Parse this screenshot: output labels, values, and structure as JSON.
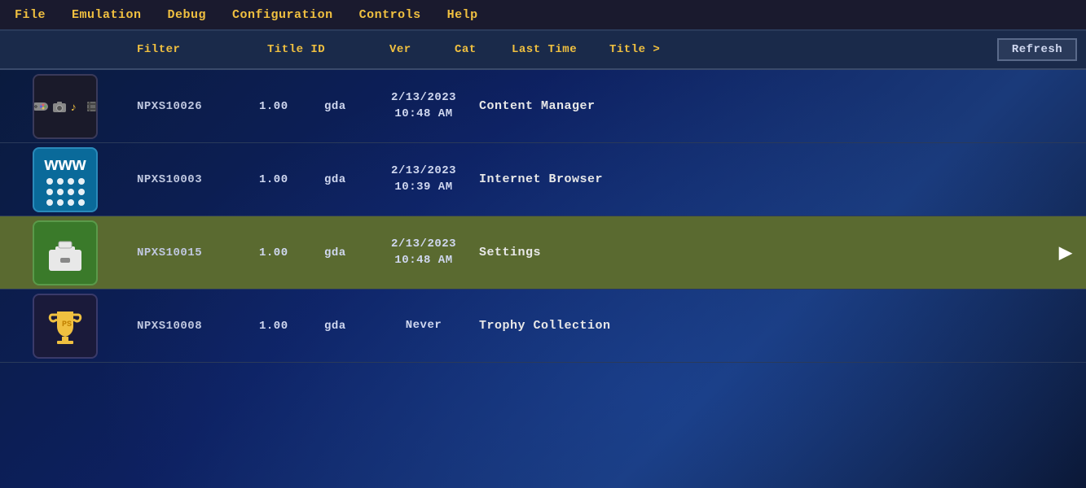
{
  "menubar": {
    "items": [
      {
        "id": "file",
        "label": "File"
      },
      {
        "id": "emulation",
        "label": "Emulation"
      },
      {
        "id": "debug",
        "label": "Debug"
      },
      {
        "id": "configuration",
        "label": "Configuration"
      },
      {
        "id": "controls",
        "label": "Controls"
      },
      {
        "id": "help",
        "label": "Help"
      }
    ]
  },
  "table": {
    "headers": {
      "filter": "Filter",
      "titleid": "Title ID",
      "ver": "Ver",
      "cat": "Cat",
      "lasttime": "Last Time",
      "title": "Title >",
      "refresh": "Refresh"
    },
    "rows": [
      {
        "id": "row-1",
        "titleid": "NPXS10026",
        "ver": "1.00",
        "cat": "gda",
        "lasttime_line1": "2/13/2023",
        "lasttime_line2": "10:48 AM",
        "title": "Content Manager",
        "icon_type": "content-manager",
        "selected": false
      },
      {
        "id": "row-2",
        "titleid": "NPXS10003",
        "ver": "1.00",
        "cat": "gda",
        "lasttime_line1": "2/13/2023",
        "lasttime_line2": "10:39 AM",
        "title": "Internet Browser",
        "icon_type": "browser",
        "selected": false
      },
      {
        "id": "row-3",
        "titleid": "NPXS10015",
        "ver": "1.00",
        "cat": "gda",
        "lasttime_line1": "2/13/2023",
        "lasttime_line2": "10:48 AM",
        "title": "Settings",
        "icon_type": "settings",
        "selected": true
      },
      {
        "id": "row-4",
        "titleid": "NPXS10008",
        "ver": "1.00",
        "cat": "gda",
        "lasttime_line1": "Never",
        "lasttime_line2": "",
        "title": "Trophy Collection",
        "icon_type": "trophy",
        "selected": false
      }
    ]
  }
}
